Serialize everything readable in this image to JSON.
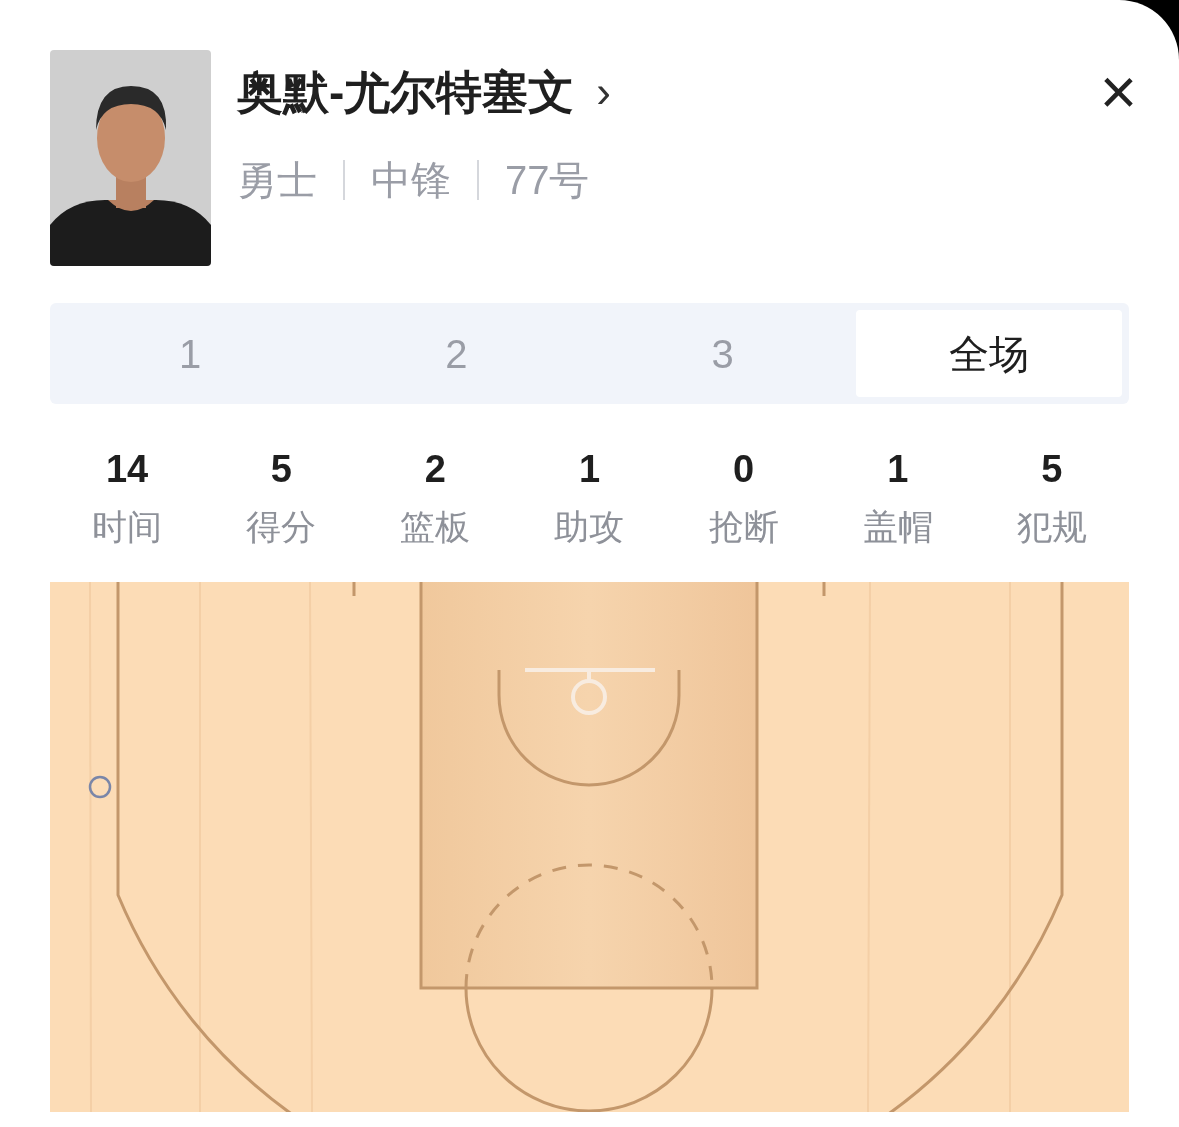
{
  "player": {
    "name": "奥默-尤尔特塞文",
    "link_glyph": "›",
    "team": "勇士",
    "position": "中锋",
    "number": "77号"
  },
  "close_glyph": "×",
  "tabs": [
    {
      "label": "1",
      "selected": false
    },
    {
      "label": "2",
      "selected": false
    },
    {
      "label": "3",
      "selected": false
    },
    {
      "label": "全场",
      "selected": true
    }
  ],
  "stats": [
    {
      "value": "14",
      "label": "时间"
    },
    {
      "value": "5",
      "label": "得分"
    },
    {
      "value": "2",
      "label": "篮板"
    },
    {
      "value": "1",
      "label": "助攻"
    },
    {
      "value": "0",
      "label": "抢断"
    },
    {
      "value": "1",
      "label": "盖帽"
    },
    {
      "value": "5",
      "label": "犯规"
    }
  ],
  "shots": [
    {
      "made": false
    }
  ]
}
